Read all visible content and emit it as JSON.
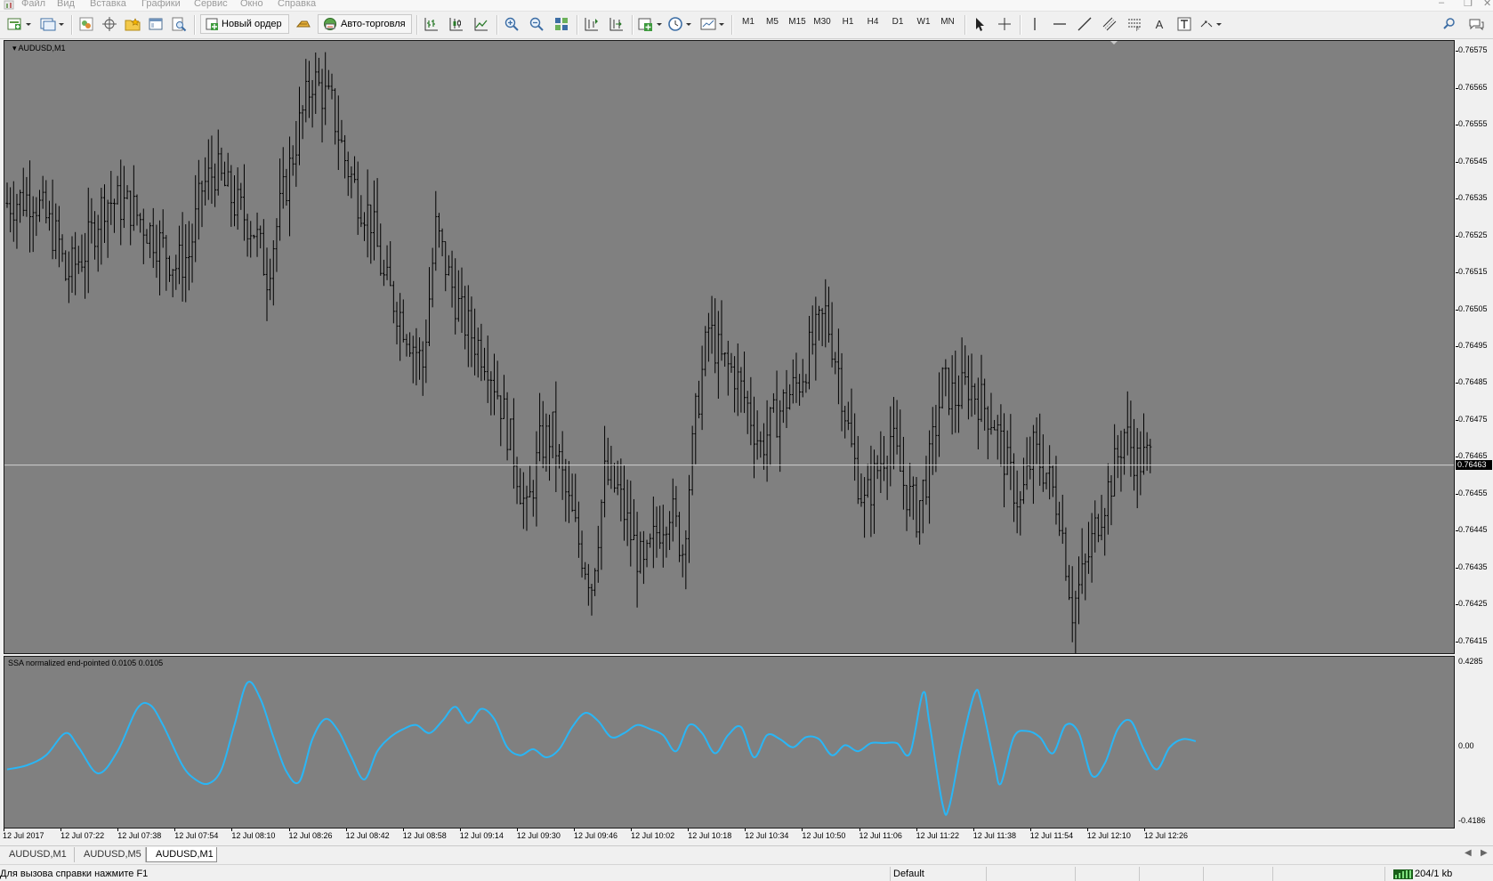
{
  "menubar": {
    "items": [
      "Файл",
      "Вид",
      "Вставка",
      "Графики",
      "Сервис",
      "Окно",
      "Справка"
    ]
  },
  "toolbar": {
    "new_order_label": "Новый ордер",
    "autotrading_label": "Авто-торговля",
    "timeframes": [
      "M1",
      "M5",
      "M15",
      "M30",
      "H1",
      "H4",
      "D1",
      "W1",
      "MN"
    ],
    "text_tool_label": "A"
  },
  "chart": {
    "title": "AUDUSD,M1",
    "current_price": "0.76463",
    "price_labels": [
      "0.76575",
      "0.76565",
      "0.76555",
      "0.76545",
      "0.76535",
      "0.76525",
      "0.76515",
      "0.76505",
      "0.76495",
      "0.76485",
      "0.76475",
      "0.76465",
      "0.76455",
      "0.76445",
      "0.76435",
      "0.76425",
      "0.76415"
    ],
    "time_labels": [
      "12 Jul 2017",
      "12 Jul 07:22",
      "12 Jul 07:38",
      "12 Jul 07:54",
      "12 Jul 08:10",
      "12 Jul 08:26",
      "12 Jul 08:42",
      "12 Jul 08:58",
      "12 Jul 09:14",
      "12 Jul 09:30",
      "12 Jul 09:46",
      "12 Jul 10:02",
      "12 Jul 10:18",
      "12 Jul 10:34",
      "12 Jul 10:50",
      "12 Jul 11:06",
      "12 Jul 11:22",
      "12 Jul 11:38",
      "12 Jul 11:54",
      "12 Jul 12:10",
      "12 Jul 12:26"
    ]
  },
  "indicator": {
    "title": "SSA normalized end-pointed 0.0105 0.0105",
    "scale_labels": [
      "0.4285",
      "0.00",
      "-0.4186"
    ],
    "line_color": "#29b6f6"
  },
  "colors": {
    "chart_background": "#808080",
    "bars": "#000000",
    "bid_line": "#d0d0d0"
  },
  "tabs": [
    "AUDUSD,M1",
    "AUDUSD,M5",
    "AUDUSD,M1"
  ],
  "active_tab": 2,
  "statusbar": {
    "help_text": "Для вызова справки нажмите F1",
    "profile": "Default",
    "traffic": "204/1 kb"
  },
  "chart_data": [
    {
      "type": "ohlc",
      "title": "AUDUSD,M1",
      "x_labels": [
        "12 Jul 2017",
        "12 Jul 07:22",
        "12 Jul 07:38",
        "12 Jul 07:54",
        "12 Jul 08:10",
        "12 Jul 08:26",
        "12 Jul 08:42",
        "12 Jul 08:58",
        "12 Jul 09:14",
        "12 Jul 09:30",
        "12 Jul 09:46",
        "12 Jul 10:02",
        "12 Jul 10:18",
        "12 Jul 10:34",
        "12 Jul 10:50",
        "12 Jul 11:06",
        "12 Jul 11:22",
        "12 Jul 11:38",
        "12 Jul 11:54",
        "12 Jul 12:10",
        "12 Jul 12:26"
      ],
      "ylim": [
        0.76412,
        0.76578
      ],
      "last_price": 0.76463,
      "close_path": [
        [
          0,
          0.76534
        ],
        [
          8,
          0.76536
        ],
        [
          16,
          0.76523
        ],
        [
          18,
          0.76514
        ],
        [
          24,
          0.76521
        ],
        [
          30,
          0.76535
        ],
        [
          38,
          0.76533
        ],
        [
          48,
          0.76522
        ],
        [
          52,
          0.76517
        ],
        [
          56,
          0.7652
        ],
        [
          60,
          0.76538
        ],
        [
          64,
          0.76543
        ],
        [
          70,
          0.76534
        ],
        [
          76,
          0.76527
        ],
        [
          80,
          0.76515
        ],
        [
          84,
          0.76532
        ],
        [
          90,
          0.76555
        ],
        [
          94,
          0.76568
        ],
        [
          100,
          0.7656
        ],
        [
          104,
          0.76546
        ],
        [
          108,
          0.76536
        ],
        [
          112,
          0.7653
        ],
        [
          116,
          0.76513
        ],
        [
          120,
          0.76506
        ],
        [
          124,
          0.76498
        ],
        [
          128,
          0.7649
        ],
        [
          132,
          0.76527
        ],
        [
          136,
          0.76514
        ],
        [
          140,
          0.76503
        ],
        [
          144,
          0.76497
        ],
        [
          148,
          0.76492
        ],
        [
          152,
          0.7648
        ],
        [
          156,
          0.76466
        ],
        [
          160,
          0.76449
        ],
        [
          164,
          0.76468
        ],
        [
          168,
          0.76472
        ],
        [
          172,
          0.76455
        ],
        [
          176,
          0.76442
        ],
        [
          180,
          0.76431
        ],
        [
          184,
          0.7646
        ],
        [
          188,
          0.76456
        ],
        [
          192,
          0.76444
        ],
        [
          196,
          0.76434
        ],
        [
          200,
          0.76445
        ],
        [
          204,
          0.76452
        ],
        [
          208,
          0.7644
        ],
        [
          212,
          0.76476
        ],
        [
          216,
          0.765
        ],
        [
          220,
          0.76491
        ],
        [
          224,
          0.76488
        ],
        [
          228,
          0.76479
        ],
        [
          232,
          0.76468
        ],
        [
          236,
          0.76475
        ],
        [
          240,
          0.76481
        ],
        [
          244,
          0.76486
        ],
        [
          248,
          0.76496
        ],
        [
          252,
          0.76504
        ],
        [
          256,
          0.76489
        ],
        [
          260,
          0.76467
        ],
        [
          264,
          0.76452
        ],
        [
          268,
          0.76462
        ],
        [
          272,
          0.76471
        ],
        [
          276,
          0.76458
        ],
        [
          280,
          0.7645
        ],
        [
          284,
          0.76463
        ],
        [
          288,
          0.76485
        ],
        [
          292,
          0.76481
        ],
        [
          296,
          0.76485
        ],
        [
          300,
          0.7648
        ],
        [
          304,
          0.76475
        ],
        [
          308,
          0.76462
        ],
        [
          312,
          0.76452
        ],
        [
          316,
          0.76467
        ],
        [
          320,
          0.76461
        ],
        [
          324,
          0.76451
        ],
        [
          328,
          0.76424
        ],
        [
          332,
          0.76435
        ],
        [
          336,
          0.76449
        ],
        [
          340,
          0.76459
        ],
        [
          344,
          0.76472
        ],
        [
          348,
          0.76464
        ],
        [
          352,
          0.76465
        ]
      ]
    },
    {
      "type": "line",
      "title": "SSA normalized end-pointed 0.0105 0.0105",
      "ylim": [
        -0.4186,
        0.4285
      ],
      "x_labels": [
        "12 Jul 2017",
        "12 Jul 07:22",
        "12 Jul 07:38",
        "12 Jul 07:54",
        "12 Jul 08:10",
        "12 Jul 08:26",
        "12 Jul 08:42",
        "12 Jul 08:58",
        "12 Jul 09:14",
        "12 Jul 09:30",
        "12 Jul 09:46",
        "12 Jul 10:02",
        "12 Jul 10:18",
        "12 Jul 10:34",
        "12 Jul 10:50",
        "12 Jul 11:06",
        "12 Jul 11:22",
        "12 Jul 11:38",
        "12 Jul 11:54",
        "12 Jul 12:10",
        "12 Jul 12:26"
      ],
      "series": [
        {
          "values": [
            [
              0,
              -0.13
            ],
            [
              6,
              -0.11
            ],
            [
              12,
              -0.06
            ],
            [
              18,
              0.05
            ],
            [
              22,
              -0.02
            ],
            [
              28,
              -0.15
            ],
            [
              34,
              -0.04
            ],
            [
              40,
              0.17
            ],
            [
              44,
              0.19
            ],
            [
              48,
              0.09
            ],
            [
              54,
              -0.11
            ],
            [
              58,
              -0.18
            ],
            [
              62,
              -0.2
            ],
            [
              66,
              -0.13
            ],
            [
              70,
              0.09
            ],
            [
              74,
              0.3
            ],
            [
              78,
              0.22
            ],
            [
              82,
              0.03
            ],
            [
              86,
              -0.14
            ],
            [
              90,
              -0.19
            ],
            [
              94,
              0.02
            ],
            [
              98,
              0.12
            ],
            [
              102,
              0.06
            ],
            [
              106,
              -0.07
            ],
            [
              110,
              -0.18
            ],
            [
              114,
              -0.04
            ],
            [
              118,
              0.03
            ],
            [
              122,
              0.07
            ],
            [
              126,
              0.09
            ],
            [
              130,
              0.05
            ],
            [
              134,
              0.11
            ],
            [
              138,
              0.18
            ],
            [
              142,
              0.1
            ],
            [
              146,
              0.17
            ],
            [
              150,
              0.12
            ],
            [
              154,
              -0.02
            ],
            [
              158,
              -0.06
            ],
            [
              162,
              -0.03
            ],
            [
              166,
              -0.07
            ],
            [
              170,
              -0.03
            ],
            [
              174,
              0.08
            ],
            [
              178,
              0.15
            ],
            [
              182,
              0.11
            ],
            [
              186,
              0.03
            ],
            [
              190,
              0.05
            ],
            [
              194,
              0.09
            ],
            [
              198,
              0.07
            ],
            [
              202,
              0.04
            ],
            [
              206,
              -0.04
            ],
            [
              210,
              0.09
            ],
            [
              214,
              0.05
            ],
            [
              218,
              -0.05
            ],
            [
              222,
              0.04
            ],
            [
              226,
              0.08
            ],
            [
              230,
              -0.07
            ],
            [
              234,
              0.04
            ],
            [
              238,
              0.02
            ],
            [
              242,
              -0.02
            ],
            [
              246,
              0.03
            ],
            [
              250,
              0.02
            ],
            [
              254,
              -0.06
            ],
            [
              258,
              -0.01
            ],
            [
              262,
              -0.04
            ],
            [
              266,
              0.0
            ],
            [
              270,
              0.0
            ],
            [
              274,
              0.0
            ],
            [
              278,
              -0.05
            ],
            [
              282,
              0.25
            ],
            [
              284,
              0.1
            ],
            [
              288,
              -0.3
            ],
            [
              290,
              -0.32
            ],
            [
              294,
              0.0
            ],
            [
              298,
              0.25
            ],
            [
              300,
              0.2
            ],
            [
              304,
              -0.1
            ],
            [
              306,
              -0.2
            ],
            [
              310,
              0.03
            ],
            [
              314,
              0.06
            ],
            [
              318,
              0.03
            ],
            [
              322,
              -0.05
            ],
            [
              326,
              0.09
            ],
            [
              330,
              0.05
            ],
            [
              334,
              -0.16
            ],
            [
              338,
              -0.1
            ],
            [
              342,
              0.07
            ],
            [
              346,
              0.11
            ],
            [
              350,
              -0.03
            ],
            [
              354,
              -0.13
            ],
            [
              358,
              -0.02
            ],
            [
              362,
              0.02
            ],
            [
              366,
              0.01
            ]
          ]
        }
      ]
    }
  ]
}
